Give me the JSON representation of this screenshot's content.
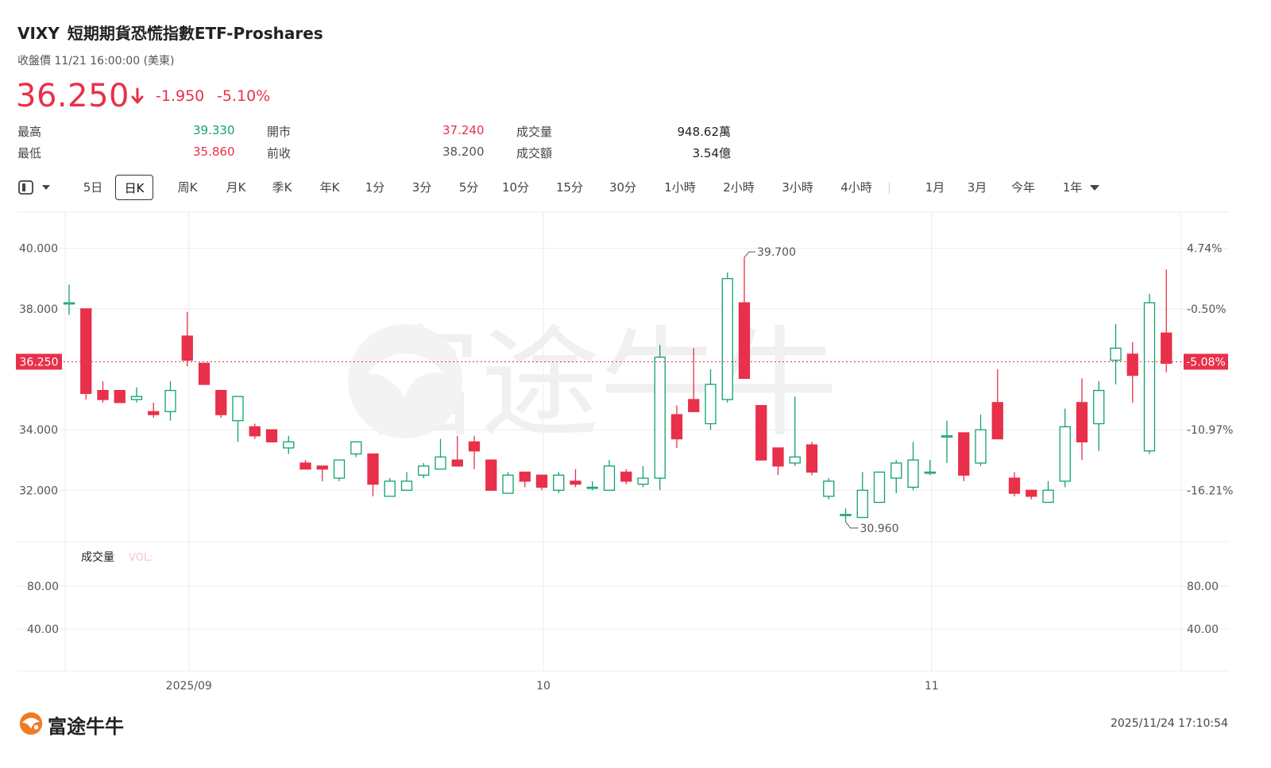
{
  "header": {
    "ticker": "VIXY",
    "name": "短期期貨恐慌指數ETF-Proshares",
    "subtitle": "收盤價 11/21 16:00:00 (美東)",
    "price": "36.250",
    "change": "-1.950",
    "change_pct": "-5.10%"
  },
  "stats": {
    "high_label": "最高",
    "high": "39.330",
    "low_label": "最低",
    "low": "35.860",
    "open_label": "開市",
    "open": "37.240",
    "prev_label": "前收",
    "prev": "38.200",
    "vol_label": "成交量",
    "vol": "948.62萬",
    "amt_label": "成交額",
    "amt": "3.54億"
  },
  "toolbar": {
    "items": [
      "5日",
      "日K",
      "周K",
      "月K",
      "季K",
      "年K",
      "1分",
      "3分",
      "5分",
      "10分",
      "15分",
      "30分",
      "1小時",
      "2小時",
      "3小時",
      "4小時",
      "1月",
      "3月",
      "今年",
      "1年"
    ],
    "selected": "日K"
  },
  "footer": {
    "brand": "富途牛牛",
    "timestamp": "2025/11/24 17:10:54"
  },
  "colors": {
    "up": "#11a36a",
    "down": "#e8304a",
    "grid": "#ececec",
    "axis": "#555555"
  },
  "chart_data": {
    "type": "candlestick",
    "y_ticks": [
      32,
      34,
      38,
      40
    ],
    "y_tick_labels": [
      "32.000",
      "34.000",
      "38.000",
      "40.000"
    ],
    "right_ticks": [
      "4.74%",
      "-0.50%",
      "-10.97%",
      "-16.21%"
    ],
    "ylim": [
      30.3,
      41.2
    ],
    "x_labels": [
      {
        "label": "2025/09",
        "index": 7
      },
      {
        "label": "10",
        "index": 28
      },
      {
        "label": "11",
        "index": 51
      }
    ],
    "current_price": 36.25,
    "current_price_label": "36.250",
    "current_pct_label": "-5.08%",
    "max_annotation": {
      "index": 40,
      "value": 39.7,
      "label": "39.700"
    },
    "min_annotation": {
      "index": 46,
      "value": 30.96,
      "label": "30.960"
    },
    "volume_label": "成交量",
    "volume_sublabel": "VOL:",
    "volume_ticks": [
      "80.00",
      "40.00"
    ],
    "candles": [
      [
        38.2,
        38.2,
        38.8,
        37.8
      ],
      [
        38.0,
        35.2,
        38.0,
        35.0
      ],
      [
        35.3,
        35.0,
        35.6,
        34.9
      ],
      [
        35.3,
        34.9,
        35.3,
        34.9
      ],
      [
        35.0,
        35.1,
        35.4,
        34.9
      ],
      [
        34.6,
        34.5,
        34.9,
        34.4
      ],
      [
        34.6,
        35.3,
        35.6,
        34.3
      ],
      [
        37.1,
        36.3,
        37.9,
        36.1
      ],
      [
        36.2,
        35.5,
        36.2,
        35.5
      ],
      [
        35.3,
        34.5,
        35.3,
        34.4
      ],
      [
        34.3,
        35.1,
        35.1,
        33.6
      ],
      [
        34.1,
        33.8,
        34.2,
        33.7
      ],
      [
        34.0,
        33.6,
        34.0,
        33.6
      ],
      [
        33.4,
        33.6,
        33.8,
        33.2
      ],
      [
        32.9,
        32.7,
        33.0,
        32.7
      ],
      [
        32.8,
        32.7,
        32.8,
        32.3
      ],
      [
        32.4,
        33.0,
        33.0,
        32.3
      ],
      [
        33.2,
        33.6,
        33.6,
        33.1
      ],
      [
        33.2,
        32.2,
        33.2,
        31.8
      ],
      [
        31.8,
        32.3,
        32.4,
        31.8
      ],
      [
        32.0,
        32.3,
        32.6,
        32.0
      ],
      [
        32.5,
        32.8,
        32.9,
        32.4
      ],
      [
        32.7,
        33.1,
        33.7,
        32.7
      ],
      [
        33.0,
        32.8,
        33.8,
        32.8
      ],
      [
        33.6,
        33.3,
        33.8,
        32.7
      ],
      [
        33.0,
        32.0,
        33.0,
        32.0
      ],
      [
        31.9,
        32.5,
        32.6,
        31.9
      ],
      [
        32.6,
        32.3,
        32.6,
        32.1
      ],
      [
        32.5,
        32.1,
        32.5,
        32.0
      ],
      [
        32.0,
        32.5,
        32.6,
        31.9
      ],
      [
        32.3,
        32.2,
        32.7,
        32.1
      ],
      [
        32.1,
        32.1,
        32.3,
        32.0
      ],
      [
        32.0,
        32.8,
        33.0,
        32.0
      ],
      [
        32.6,
        32.3,
        32.7,
        32.2
      ],
      [
        32.2,
        32.4,
        32.8,
        32.1
      ],
      [
        32.4,
        36.4,
        36.8,
        32.0
      ],
      [
        34.5,
        33.7,
        34.8,
        33.4
      ],
      [
        35.0,
        34.6,
        36.7,
        34.6
      ],
      [
        34.2,
        35.5,
        36.0,
        34.0
      ],
      [
        35.0,
        39.0,
        39.2,
        34.9
      ],
      [
        38.2,
        35.7,
        39.7,
        35.7
      ],
      [
        34.8,
        33.0,
        34.8,
        33.0
      ],
      [
        33.4,
        32.8,
        33.4,
        32.5
      ],
      [
        32.9,
        33.1,
        35.1,
        32.8
      ],
      [
        33.5,
        32.6,
        33.6,
        32.5
      ],
      [
        31.8,
        32.3,
        32.4,
        31.7
      ],
      [
        31.2,
        31.2,
        31.4,
        30.96
      ],
      [
        31.1,
        32.0,
        32.6,
        31.1
      ],
      [
        31.6,
        32.6,
        32.6,
        31.6
      ],
      [
        32.4,
        32.9,
        33.0,
        31.9
      ],
      [
        32.1,
        33.0,
        33.6,
        32.0
      ],
      [
        32.6,
        32.6,
        33.0,
        32.5
      ],
      [
        33.8,
        33.8,
        34.3,
        32.9
      ],
      [
        33.9,
        32.5,
        33.9,
        32.3
      ],
      [
        32.9,
        34.0,
        34.5,
        32.8
      ],
      [
        34.9,
        33.7,
        36.0,
        33.7
      ],
      [
        32.4,
        31.9,
        32.6,
        31.8
      ],
      [
        32.0,
        31.8,
        32.0,
        31.7
      ],
      [
        31.6,
        32.0,
        32.3,
        31.6
      ],
      [
        32.3,
        34.1,
        34.7,
        32.1
      ],
      [
        34.9,
        33.6,
        35.7,
        33.0
      ],
      [
        34.2,
        35.3,
        35.6,
        33.3
      ],
      [
        36.3,
        36.7,
        37.5,
        35.5
      ],
      [
        36.5,
        35.8,
        36.9,
        34.9
      ],
      [
        33.3,
        38.2,
        38.5,
        33.2
      ],
      [
        37.2,
        36.2,
        39.3,
        35.9
      ]
    ]
  }
}
